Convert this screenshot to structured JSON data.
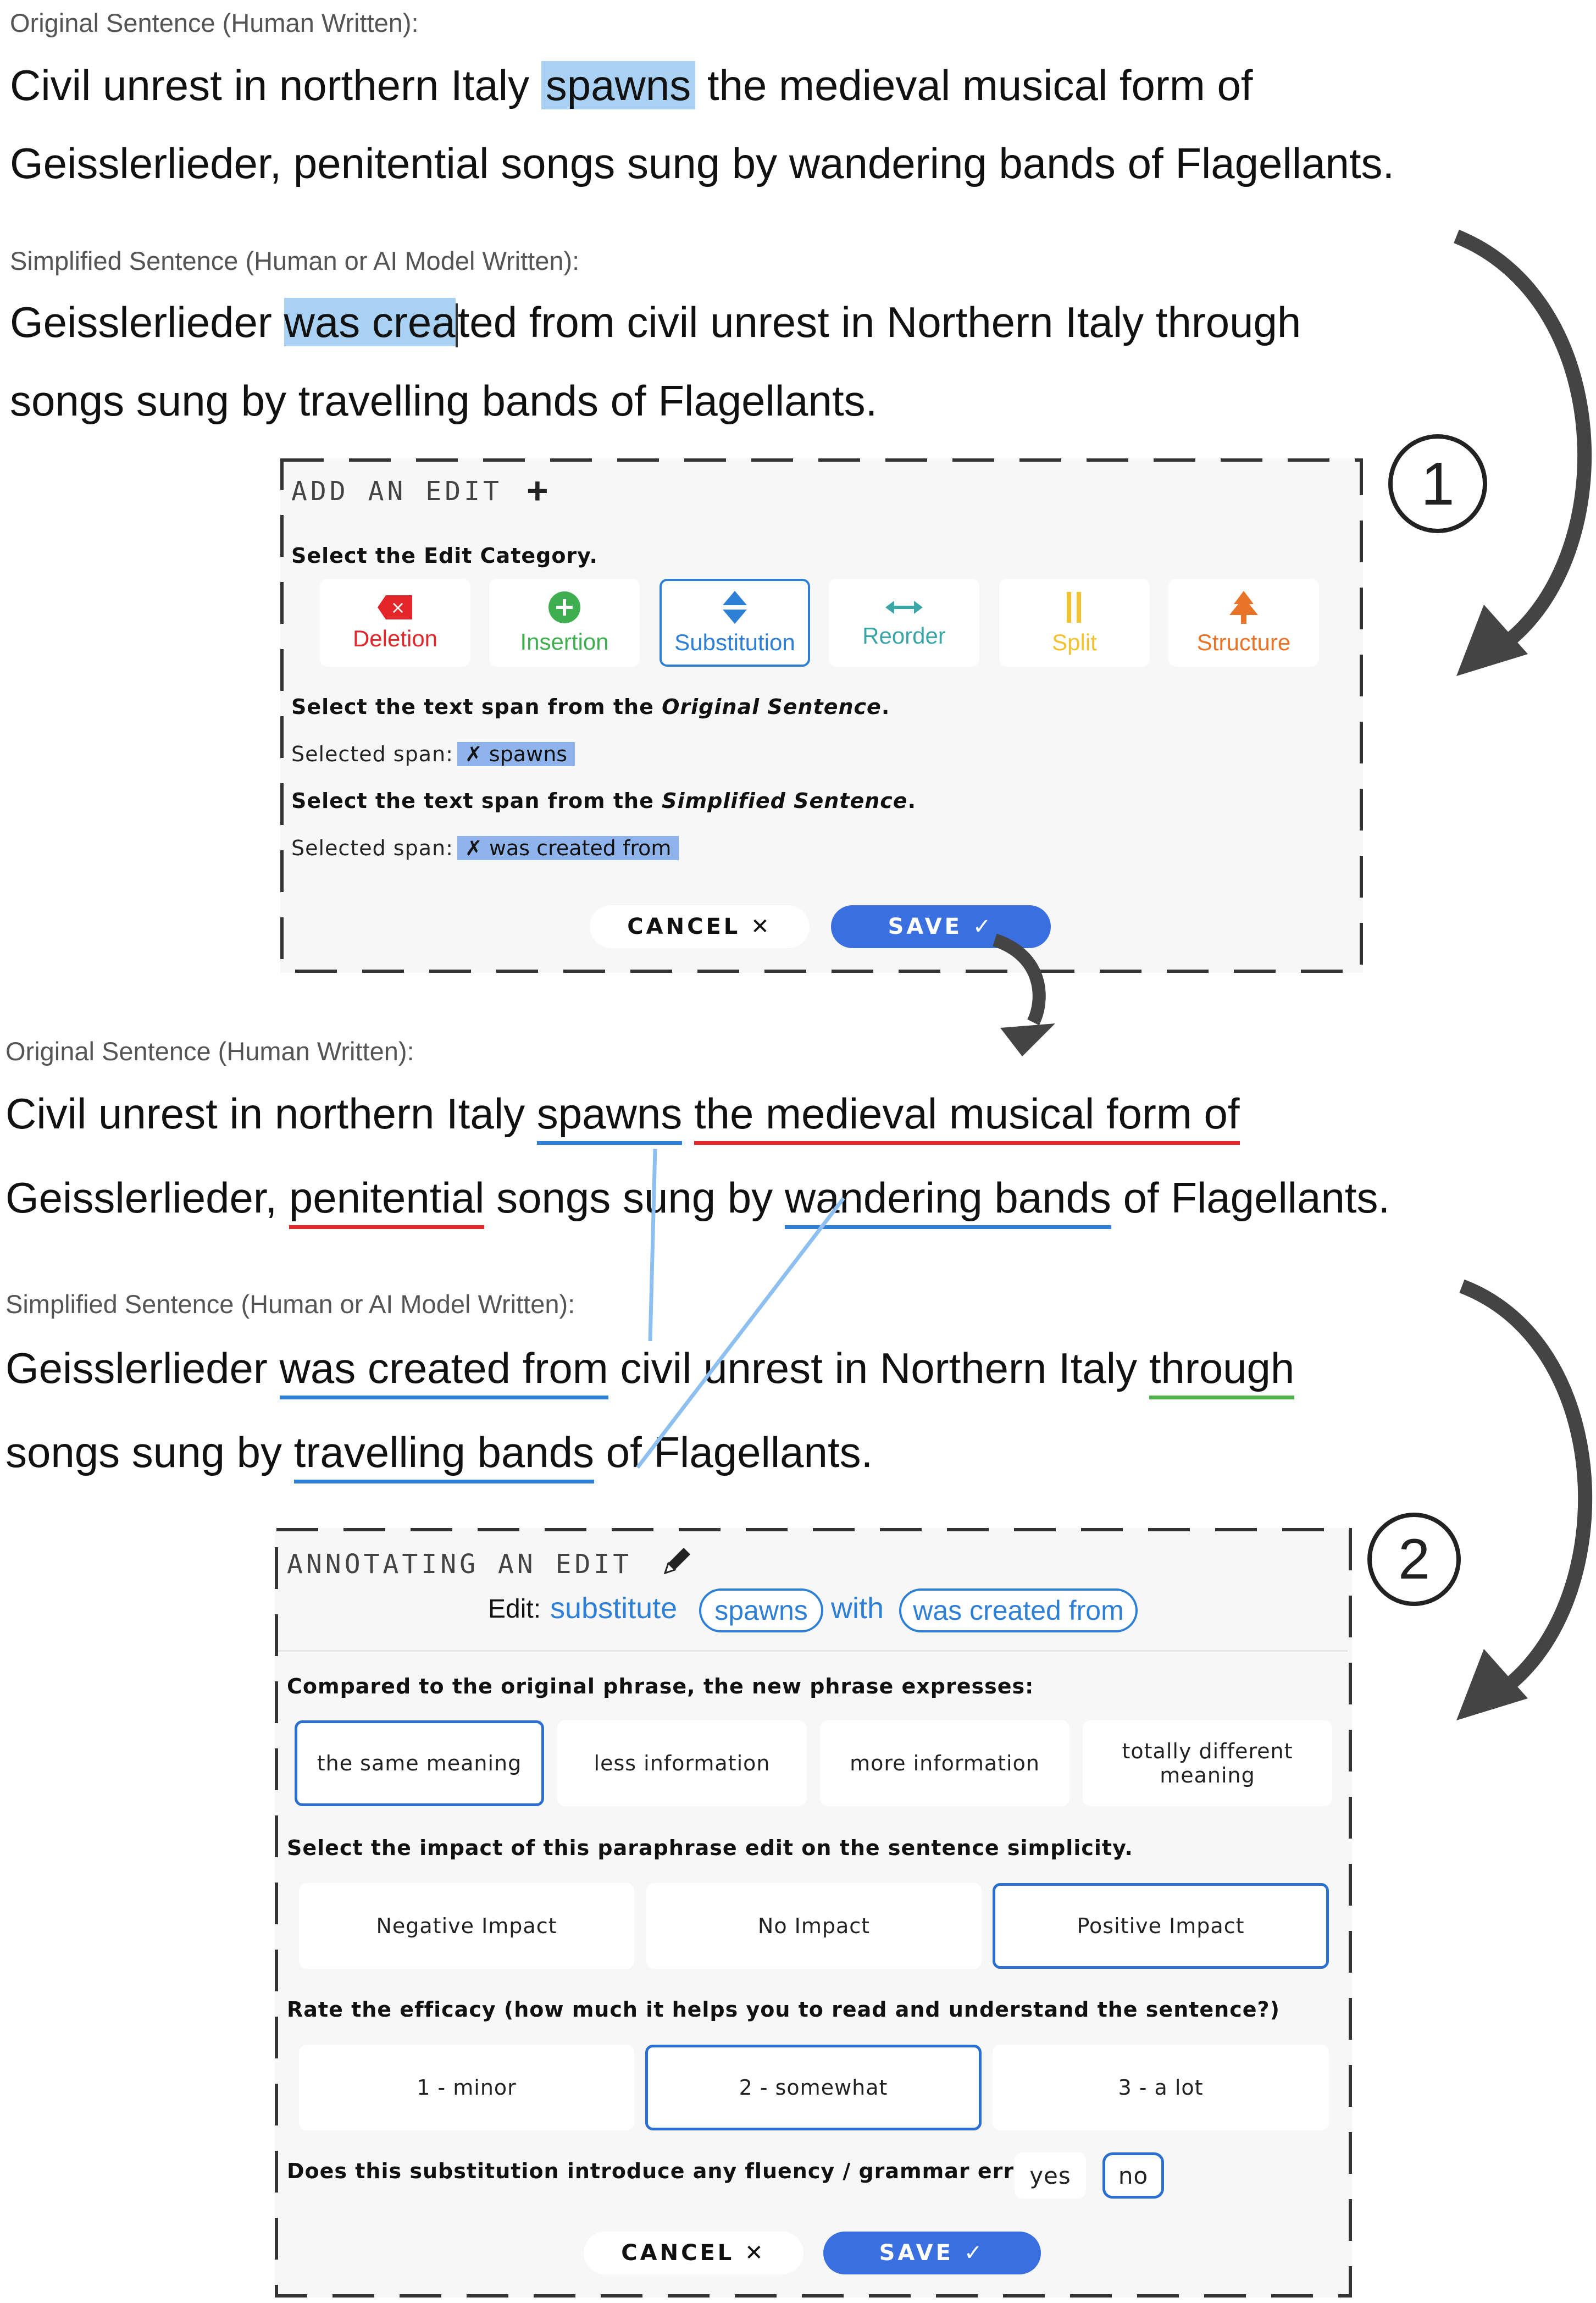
{
  "top": {
    "original_caption": "Original Sentence (Human Written):",
    "orig_line1": {
      "a": "Civil unrest in northern Italy ",
      "hl": "spawns",
      "b": " the medieval musical form of"
    },
    "orig_line2": "Geisslerlieder, penitential songs sung by wandering bands of Flagellants.",
    "simplified_caption": "Simplified Sentence (Human or AI Model Written):",
    "simp_line1": {
      "a": "Geisslerlieder ",
      "hl": "was crea",
      "b": "ted from civil unrest in Northern Italy through"
    },
    "simp_line2": "songs sung by travelling bands of Flagellants."
  },
  "add_edit": {
    "title": "ADD AN EDIT",
    "title_icon": "plus-icon",
    "step": "1",
    "category_prompt": "Select the Edit Category.",
    "categories": [
      {
        "label": "Deletion",
        "icon": "delete-icon",
        "color": "#e2262a"
      },
      {
        "label": "Insertion",
        "icon": "plus-circle-icon",
        "color": "#3fae4f"
      },
      {
        "label": "Substitution",
        "icon": "swap-vertical-icon",
        "color": "#2e7fd6"
      },
      {
        "label": "Reorder",
        "icon": "arrows-horizontal-icon",
        "color": "#3aa6a6"
      },
      {
        "label": "Split",
        "icon": "split-icon",
        "color": "#f2c230"
      },
      {
        "label": "Structure",
        "icon": "tree-icon",
        "color": "#e8742a"
      }
    ],
    "orig_span_prompt_a": "Select the text span from the ",
    "orig_span_prompt_b": "Original Sentence",
    "orig_span_prompt_c": ".",
    "selected_span_label": "Selected span:",
    "orig_span": "✗ spawns",
    "simp_span_prompt_a": "Select the text span from the ",
    "simp_span_prompt_b": "Simplified Sentence",
    "simp_span_prompt_c": ".",
    "simp_span": "✗ was created from",
    "cancel": "CANCEL ✕",
    "save": "SAVE ✓"
  },
  "middle": {
    "original_caption": "Original Sentence (Human Written):",
    "orig_line1": {
      "a": "Civil unrest in northern Italy ",
      "u1": "spawns",
      "sp": " ",
      "u2": "the medieval musical form of"
    },
    "orig_line2": {
      "a": "Geisslerlieder, ",
      "u1": "penitential",
      "b": " songs sung by ",
      "u2": "wandering bands",
      "c": " of Flagellants."
    },
    "simplified_caption": "Simplified Sentence (Human or AI Model Written):",
    "simp_line1": {
      "a": "Geisslerlieder ",
      "u1": "was created from",
      "b": " civil unrest in Northern Italy ",
      "u2": "through"
    },
    "simp_line2": {
      "a": "songs sung by ",
      "u1": "travelling bands",
      "b": " of Flagellants."
    }
  },
  "annotate": {
    "title": "ANNOTATING AN EDIT",
    "title_icon": "pencil-icon",
    "step": "2",
    "edit_label": "Edit:",
    "edit_verb": "substitute",
    "edit_from": "spawns",
    "edit_with": "with",
    "edit_to": "was created from",
    "q1": "Compared to the original phrase, the new phrase expresses:",
    "q1_options": [
      "the same meaning",
      "less information",
      "more information",
      "totally different meaning"
    ],
    "q1_selected": "the same meaning",
    "q2": "Select the impact of this paraphrase edit on the sentence simplicity.",
    "q2_options": [
      "Negative Impact",
      "No Impact",
      "Positive Impact"
    ],
    "q2_selected": "Positive Impact",
    "q3": "Rate the efficacy (how much it helps you to read and understand the sentence?)",
    "q3_options": [
      "1 - minor",
      "2 - somewhat",
      "3 - a lot"
    ],
    "q3_selected": "2 - somewhat",
    "q4": "Does this substitution introduce any fluency / grammar error?",
    "q4_options": [
      "yes",
      "no"
    ],
    "q4_selected": "no",
    "cancel": "CANCEL ✕",
    "save": "SAVE ✓"
  }
}
